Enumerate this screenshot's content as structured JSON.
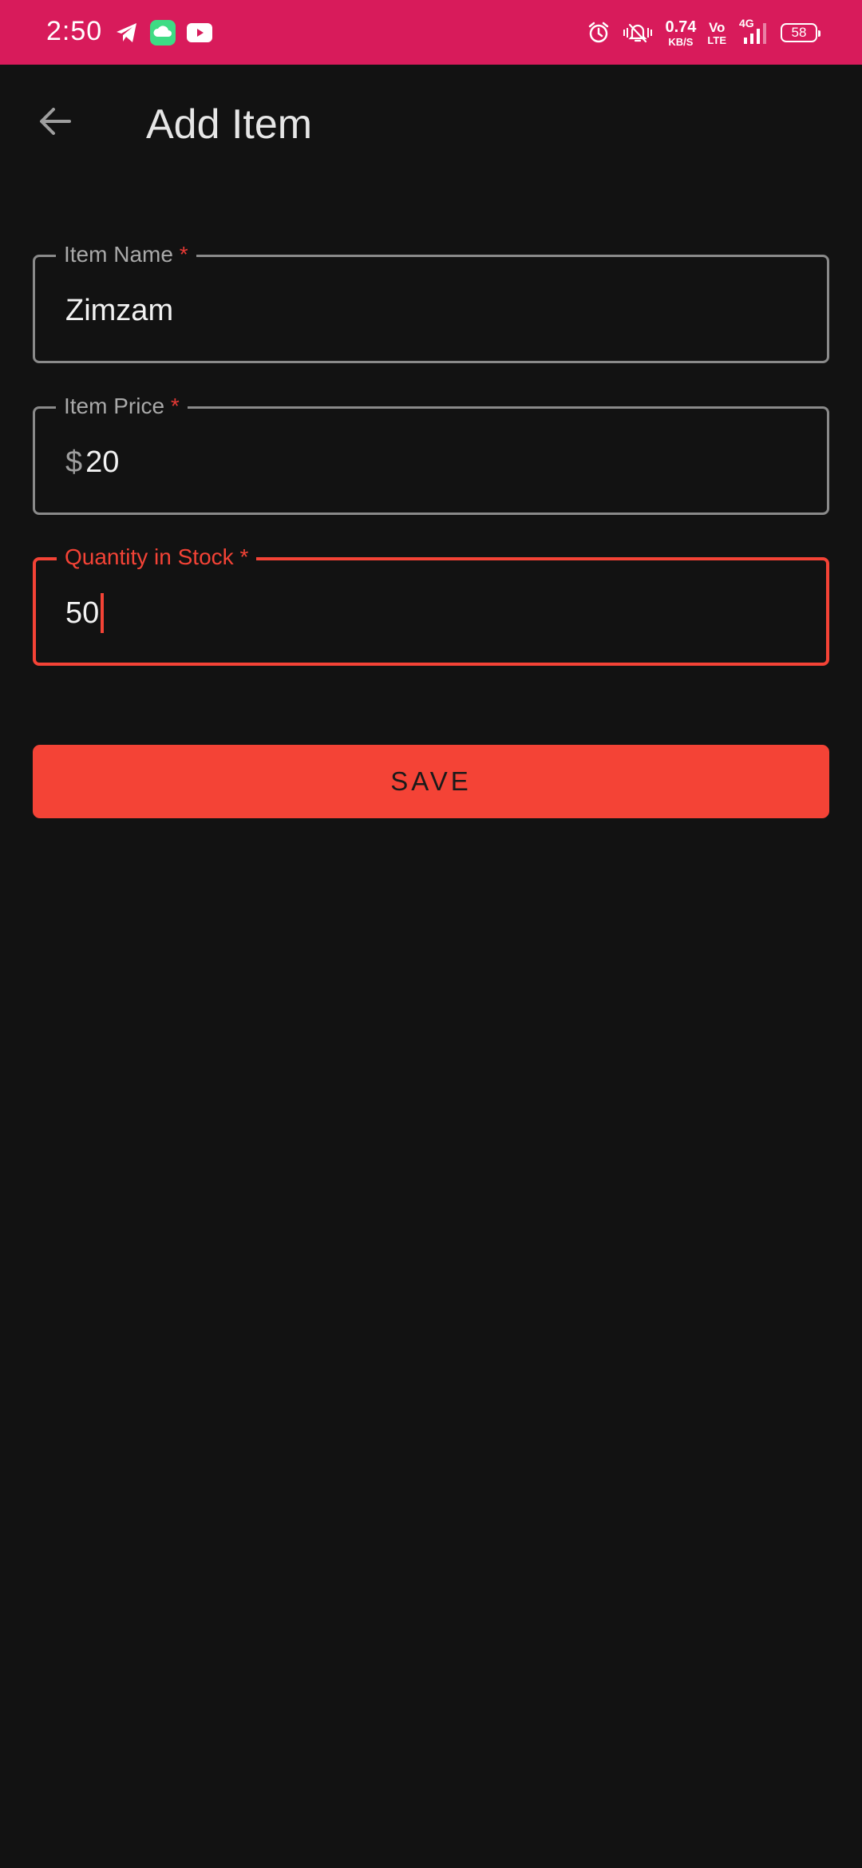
{
  "status_bar": {
    "time": "2:50",
    "notification_icons": [
      "telegram-icon",
      "cloud-app-icon",
      "youtube-icon"
    ],
    "net_speed_value": "0.74",
    "net_speed_unit": "KB/S",
    "volte_top": "Vo",
    "volte_bottom": "LTE",
    "network_type": "4G",
    "battery_level": "58",
    "background_color": "#d81b5b"
  },
  "app_bar": {
    "back_icon": "arrow-left-icon",
    "title": "Add Item"
  },
  "form": {
    "item_name": {
      "label": "Item Name",
      "required_mark": "*",
      "value": "Zimzam"
    },
    "item_price": {
      "label": "Item Price",
      "required_mark": "*",
      "prefix": "$",
      "value": "20"
    },
    "quantity": {
      "label": "Quantity in Stock",
      "required_mark": "*",
      "value": "50",
      "focused": true
    }
  },
  "save_button": {
    "label": "SAVE",
    "color": "#f44336"
  },
  "theme": {
    "background": "#121212",
    "accent": "#f44336",
    "outline": "#8a8a8a"
  }
}
